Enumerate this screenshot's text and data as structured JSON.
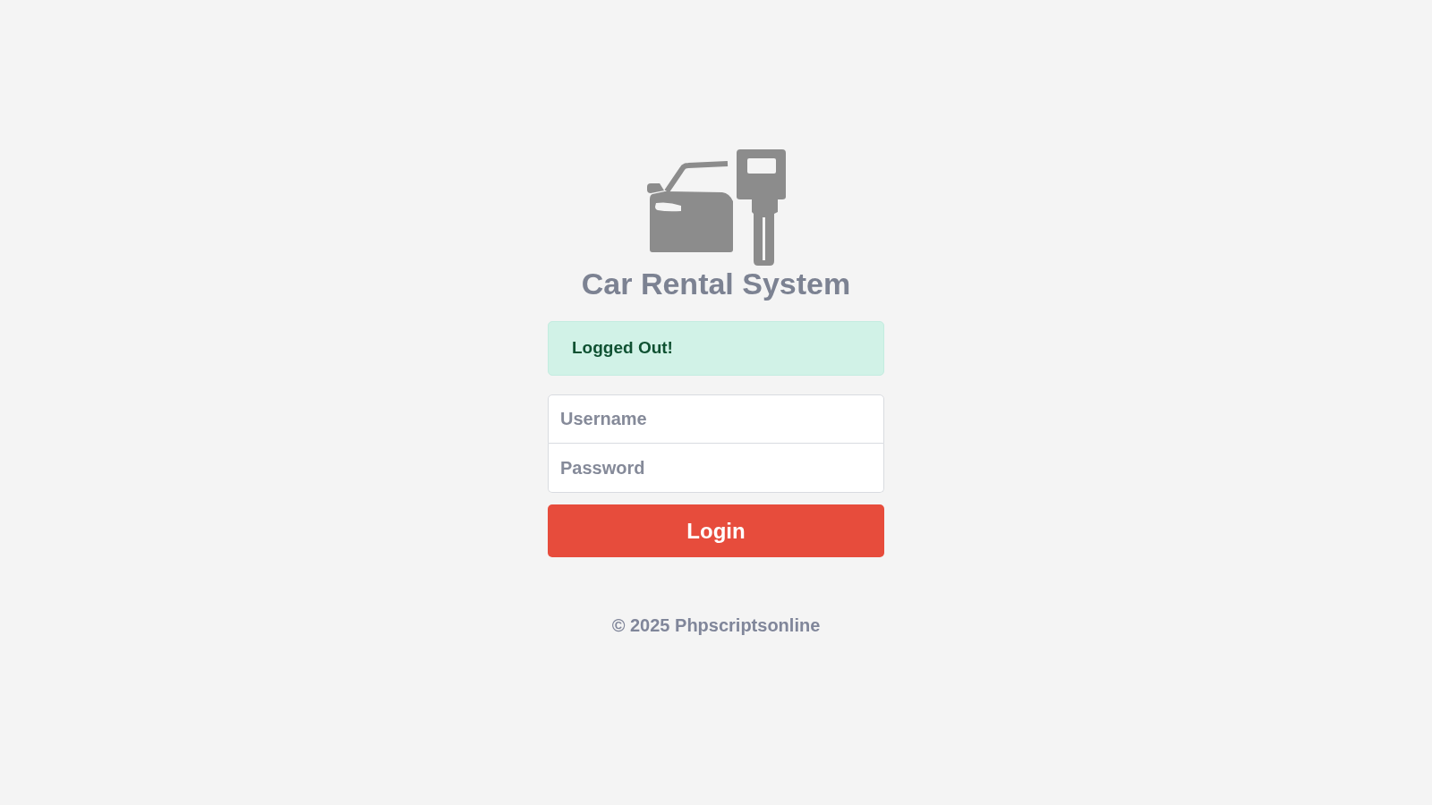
{
  "header": {
    "title": "Car Rental System"
  },
  "alert": {
    "kind": "success",
    "message": "Logged Out!"
  },
  "form": {
    "fields": [
      {
        "placeholder": "Username"
      },
      {
        "placeholder": "Password"
      }
    ],
    "submit": "Login"
  },
  "footer": "© 2025 Phpscriptsonline"
}
